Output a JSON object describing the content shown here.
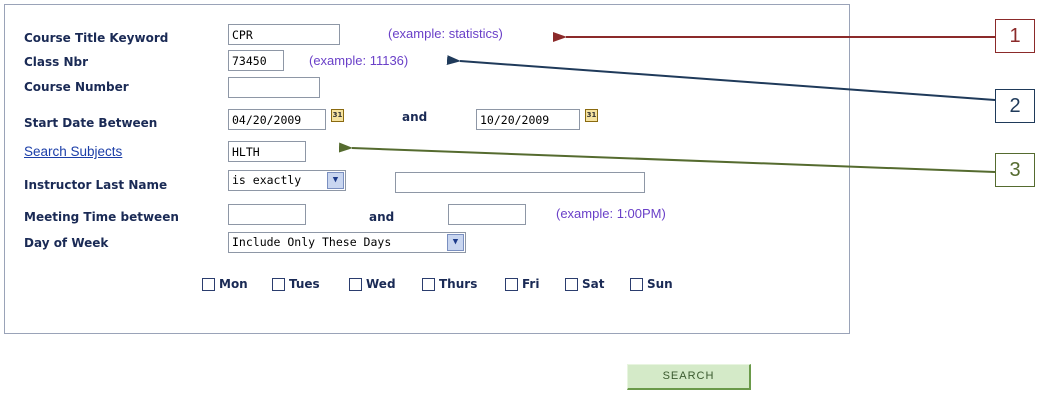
{
  "form": {
    "course_title_label": "Course Title Keyword",
    "course_title_value": "CPR",
    "course_title_example": "(example: statistics)",
    "class_nbr_label": "Class Nbr",
    "class_nbr_value": "73450",
    "class_nbr_example": "(example: 11136)",
    "course_number_label": "Course Number",
    "course_number_value": "",
    "start_date_label": "Start Date Between",
    "start_date_from": "04/20/2009",
    "and_label": "and",
    "start_date_to": "10/20/2009",
    "calendar_icon_text": "31",
    "search_subjects_link": "Search Subjects",
    "subject_value": "HLTH",
    "instructor_label": "Instructor Last Name",
    "instructor_operator": "is exactly",
    "instructor_value": "",
    "meeting_time_label": "Meeting Time between",
    "meeting_time_from": "",
    "meeting_time_to": "",
    "meeting_time_example": "(example: 1:00PM)",
    "day_of_week_label": "Day of Week",
    "day_of_week_option": "Include Only These Days",
    "days": [
      "Mon",
      "Tues",
      "Wed",
      "Thurs",
      "Fri",
      "Sat",
      "Sun"
    ]
  },
  "search_button": "SEARCH",
  "callouts": [
    {
      "number": "1",
      "color": "#8b2a2a"
    },
    {
      "number": "2",
      "color": "#1f3a5a"
    },
    {
      "number": "3",
      "color": "#556b2f"
    }
  ],
  "colors": {
    "label": "#1a2a55",
    "example": "#6a40c8",
    "link": "#1b3ea8",
    "panel_border": "#9aa3b8",
    "button_bg": "#d4eac8"
  }
}
